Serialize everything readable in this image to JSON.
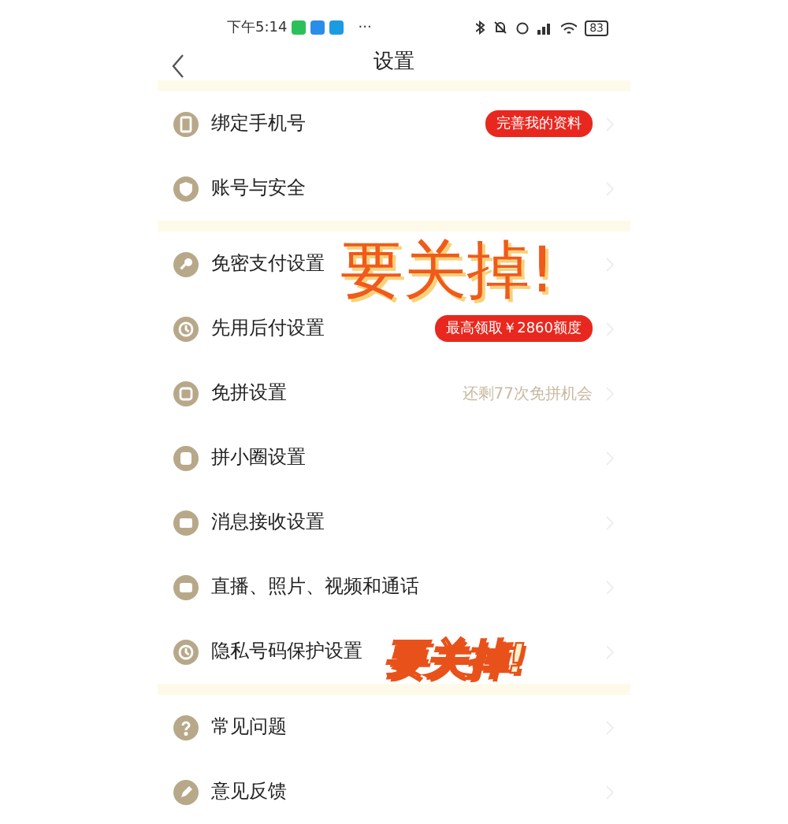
{
  "status_bar": {
    "time": "下午5:14",
    "more": "···",
    "battery": "83"
  },
  "header": {
    "title": "设置"
  },
  "sections": [
    {
      "items": [
        {
          "label": "绑定手机号",
          "badge": "完善我的资料"
        },
        {
          "label": "账号与安全"
        }
      ]
    },
    {
      "items": [
        {
          "label": "免密支付设置"
        },
        {
          "label": "先用后付设置",
          "badge": "最高领取￥2860额度"
        },
        {
          "label": "免拼设置",
          "value": "还剩77次免拼机会"
        },
        {
          "label": "拼小圈设置"
        },
        {
          "label": "消息接收设置"
        },
        {
          "label": "直播、照片、视频和通话"
        },
        {
          "label": "隐私号码保护设置"
        }
      ]
    },
    {
      "items": [
        {
          "label": "常见问题"
        },
        {
          "label": "意见反馈"
        }
      ]
    }
  ],
  "overlay_notes": [
    {
      "text": "要关掉!"
    },
    {
      "text": "要关掉!"
    }
  ]
}
